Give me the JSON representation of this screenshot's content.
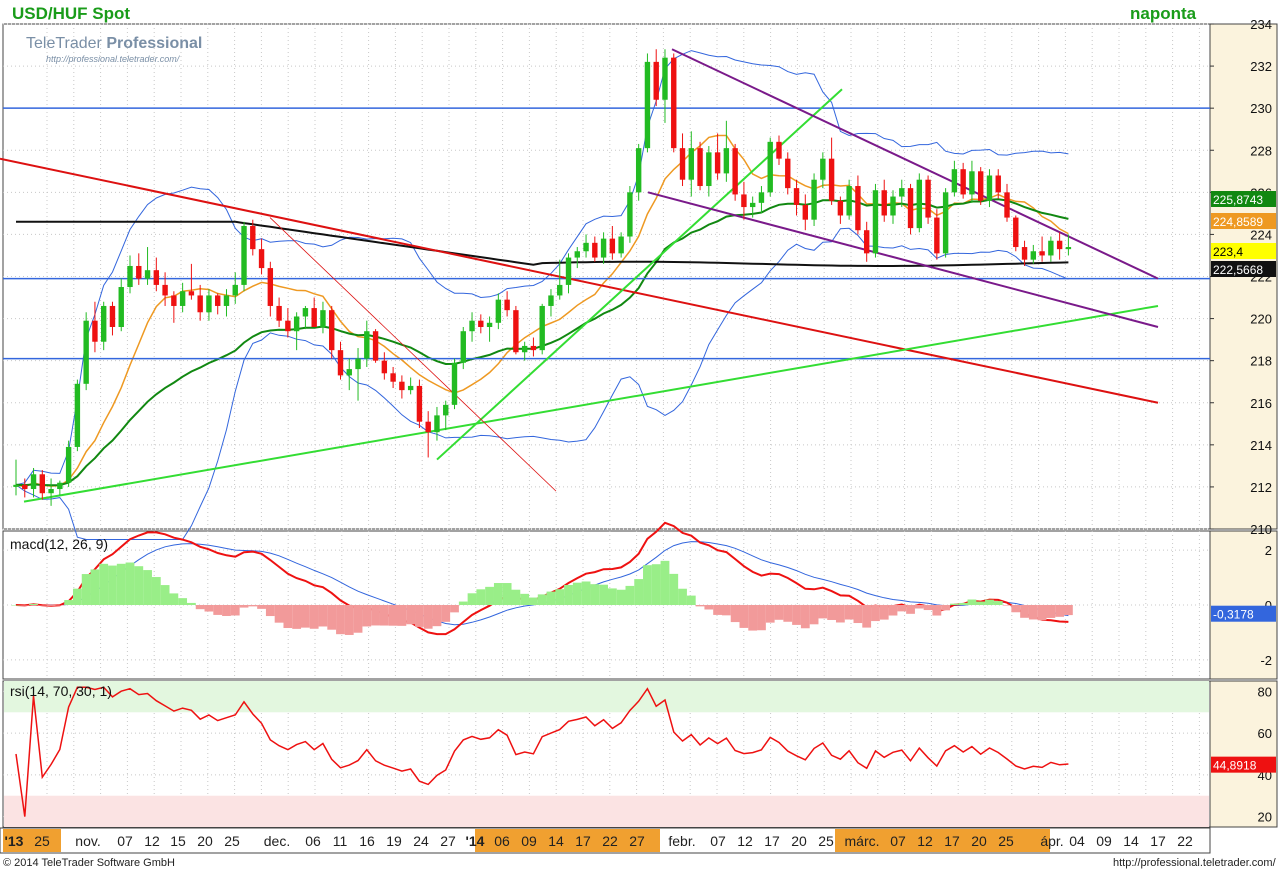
{
  "header": {
    "title": "USD/HUF Spot",
    "timeframe": "naponta",
    "logo_main": "TeleTrader",
    "logo_bold": "Professional",
    "logo_url": "http://professional.teletrader.com/"
  },
  "footer": {
    "copyright": "© 2014 TeleTrader Software GmbH",
    "url": "http://professional.teletrader.com/"
  },
  "x_axis": {
    "labels": [
      "'13",
      "25",
      "nov.",
      "07",
      "12",
      "15",
      "20",
      "25",
      "dec.",
      "06",
      "11",
      "16",
      "19",
      "24",
      "27",
      "'14",
      "06",
      "09",
      "14",
      "17",
      "22",
      "27",
      "febr.",
      "07",
      "12",
      "17",
      "20",
      "25",
      "márc.",
      "07",
      "12",
      "17",
      "20",
      "25",
      "ápr.",
      "04",
      "09",
      "14",
      "17",
      "22"
    ]
  },
  "colors": {
    "price_up": "#22bb22",
    "price_down": "#ee1111",
    "bollinger": "#3366dd",
    "sma_short": "#ee9922",
    "sma_mid": "#118811",
    "sma_long": "#111111",
    "trend_red": "#dd1111",
    "trend_green": "#33dd33",
    "channel_purple": "#7a1a8a",
    "support_blue": "#3366dd",
    "axis_strip": "#f0a030"
  },
  "chart_data": [
    {
      "type": "line",
      "title": "USD/HUF Spot",
      "ylim": [
        210,
        234
      ],
      "y_ticks": [
        "234",
        "232",
        "230",
        "228",
        "226",
        "224",
        "222",
        "220",
        "218",
        "216",
        "214",
        "212",
        "210"
      ],
      "price_labels": [
        {
          "value": 225.8743,
          "text": "225,8743",
          "bg": "#118811",
          "fg": "#ffffff"
        },
        {
          "value": 224.8589,
          "text": "224,8589",
          "bg": "#ee9922",
          "fg": "#ffffff"
        },
        {
          "value": 223.4,
          "text": "223,4",
          "bg": "#ffff00",
          "fg": "#000000"
        },
        {
          "value": 222.5668,
          "text": "222,5668",
          "bg": "#111111",
          "fg": "#ffffff"
        }
      ],
      "horizontal_lines": [
        230.0,
        221.9,
        218.1
      ],
      "trend_lines": [
        {
          "color": "red",
          "from": [
            0,
            227.6
          ],
          "to": [
            1158,
            216.0
          ]
        },
        {
          "color": "green",
          "from": [
            24,
            211.3
          ],
          "to": [
            1158,
            220.6
          ]
        },
        {
          "color": "green",
          "from": [
            437,
            213.3
          ],
          "to": [
            842,
            230.9
          ]
        },
        {
          "color": "red_thin",
          "from": [
            270,
            224.8
          ],
          "to": [
            556,
            211.8
          ]
        },
        {
          "color": "purple",
          "from": [
            672,
            232.8
          ],
          "to": [
            1158,
            221.9
          ]
        },
        {
          "color": "purple",
          "from": [
            648,
            226.0
          ],
          "to": [
            1158,
            219.6
          ]
        }
      ],
      "candles": [
        [
          212,
          213.3,
          211.6,
          212.1
        ],
        [
          212.1,
          212.4,
          211.5,
          211.9
        ],
        [
          211.9,
          212.9,
          211.5,
          212.6
        ],
        [
          212.6,
          212.8,
          211.4,
          211.7
        ],
        [
          211.7,
          212.4,
          211.1,
          211.9
        ],
        [
          211.9,
          212.3,
          211.6,
          212.2
        ],
        [
          212.2,
          214.2,
          212.0,
          213.9
        ],
        [
          213.9,
          217.1,
          213.7,
          216.9
        ],
        [
          216.9,
          220.3,
          216.6,
          219.9
        ],
        [
          219.9,
          220.8,
          218.4,
          218.9
        ],
        [
          218.9,
          220.8,
          218.5,
          220.6
        ],
        [
          220.6,
          220.8,
          219.2,
          219.6
        ],
        [
          219.6,
          221.9,
          219.4,
          221.5
        ],
        [
          221.5,
          223.0,
          221.2,
          222.5
        ],
        [
          222.5,
          223.1,
          221.6,
          221.9
        ],
        [
          221.9,
          223.4,
          221.6,
          222.3
        ],
        [
          222.3,
          222.9,
          221.3,
          221.6
        ],
        [
          221.6,
          222.2,
          220.6,
          221.1
        ],
        [
          221.1,
          221.3,
          219.8,
          220.6
        ],
        [
          220.6,
          221.7,
          220.3,
          221.3
        ],
        [
          221.3,
          222.6,
          220.9,
          221.1
        ],
        [
          221.1,
          221.6,
          219.9,
          220.3
        ],
        [
          220.3,
          221.4,
          219.9,
          221.1
        ],
        [
          221.1,
          221.2,
          220.2,
          220.6
        ],
        [
          220.6,
          221.4,
          220.1,
          221.1
        ],
        [
          221.1,
          222.2,
          220.7,
          221.6
        ],
        [
          221.6,
          224.6,
          221.3,
          224.4
        ],
        [
          224.4,
          224.7,
          223.0,
          223.3
        ],
        [
          223.3,
          223.8,
          222.1,
          222.4
        ],
        [
          222.4,
          222.7,
          220.1,
          220.6
        ],
        [
          220.6,
          221.0,
          219.6,
          219.9
        ],
        [
          219.9,
          220.5,
          219.1,
          219.4
        ],
        [
          219.4,
          220.3,
          218.5,
          220.1
        ],
        [
          220.1,
          220.6,
          219.5,
          220.5
        ],
        [
          220.5,
          221.0,
          219.6,
          219.6
        ],
        [
          219.6,
          220.8,
          219.3,
          220.4
        ],
        [
          220.4,
          220.6,
          218.1,
          218.5
        ],
        [
          218.5,
          218.9,
          217.1,
          217.3
        ],
        [
          217.3,
          218.1,
          216.6,
          217.6
        ],
        [
          217.6,
          218.6,
          216.1,
          218.1
        ],
        [
          218.1,
          219.9,
          217.7,
          219.4
        ],
        [
          219.4,
          219.5,
          217.9,
          218.0
        ],
        [
          218.0,
          218.4,
          217.1,
          217.4
        ],
        [
          217.4,
          217.7,
          216.7,
          217.0
        ],
        [
          217.0,
          217.3,
          216.2,
          216.6
        ],
        [
          216.6,
          217.2,
          216.4,
          216.8
        ],
        [
          216.8,
          217.1,
          214.8,
          215.1
        ],
        [
          215.1,
          215.6,
          213.4,
          214.6
        ],
        [
          214.6,
          215.8,
          214.2,
          215.4
        ],
        [
          215.4,
          216.1,
          214.7,
          215.9
        ],
        [
          215.9,
          218.1,
          215.7,
          217.9
        ],
        [
          217.9,
          219.6,
          217.6,
          219.4
        ],
        [
          219.4,
          220.3,
          218.9,
          219.9
        ],
        [
          219.9,
          220.2,
          219.3,
          219.6
        ],
        [
          219.6,
          220.1,
          218.9,
          219.8
        ],
        [
          219.8,
          221.2,
          219.5,
          220.9
        ],
        [
          220.9,
          221.3,
          220.1,
          220.4
        ],
        [
          220.4,
          220.6,
          218.3,
          218.4
        ],
        [
          218.4,
          218.9,
          218.0,
          218.7
        ],
        [
          218.7,
          219.1,
          218.2,
          218.5
        ],
        [
          218.5,
          220.7,
          218.3,
          220.6
        ],
        [
          220.6,
          221.4,
          220.1,
          221.1
        ],
        [
          221.1,
          222.8,
          220.9,
          221.6
        ],
        [
          221.6,
          223.1,
          221.2,
          222.9
        ],
        [
          222.9,
          223.4,
          222.4,
          223.2
        ],
        [
          223.2,
          224.0,
          222.9,
          223.6
        ],
        [
          223.6,
          223.9,
          222.7,
          222.9
        ],
        [
          222.9,
          224.1,
          222.6,
          223.8
        ],
        [
          223.8,
          224.4,
          222.8,
          223.1
        ],
        [
          223.1,
          224.1,
          222.9,
          223.9
        ],
        [
          223.9,
          226.3,
          223.6,
          226.0
        ],
        [
          226.0,
          228.3,
          225.6,
          228.1
        ],
        [
          228.1,
          232.6,
          227.9,
          232.2
        ],
        [
          232.2,
          232.8,
          230.1,
          230.4
        ],
        [
          230.4,
          232.8,
          229.3,
          232.4
        ],
        [
          232.4,
          232.6,
          227.9,
          228.1
        ],
        [
          228.1,
          228.8,
          226.3,
          226.6
        ],
        [
          226.6,
          228.9,
          225.8,
          228.1
        ],
        [
          228.1,
          228.4,
          226.1,
          226.3
        ],
        [
          226.3,
          228.2,
          225.8,
          227.9
        ],
        [
          227.9,
          228.8,
          226.6,
          226.9
        ],
        [
          226.9,
          229.4,
          226.5,
          228.1
        ],
        [
          228.1,
          228.3,
          225.6,
          225.9
        ],
        [
          225.9,
          226.5,
          224.7,
          225.3
        ],
        [
          225.3,
          225.8,
          224.8,
          225.5
        ],
        [
          225.5,
          226.3,
          225.0,
          226.0
        ],
        [
          226.0,
          228.6,
          225.8,
          228.4
        ],
        [
          228.4,
          228.7,
          227.3,
          227.6
        ],
        [
          227.6,
          227.9,
          225.9,
          226.2
        ],
        [
          226.2,
          226.6,
          224.9,
          225.4
        ],
        [
          225.4,
          225.9,
          224.2,
          224.7
        ],
        [
          224.7,
          226.9,
          224.4,
          226.6
        ],
        [
          226.6,
          227.9,
          226.2,
          227.6
        ],
        [
          227.6,
          228.6,
          225.4,
          225.6
        ],
        [
          225.6,
          225.8,
          224.5,
          224.9
        ],
        [
          224.9,
          226.6,
          224.7,
          226.3
        ],
        [
          226.3,
          226.8,
          224.0,
          224.2
        ],
        [
          224.2,
          224.6,
          222.7,
          223.1
        ],
        [
          223.1,
          226.4,
          222.9,
          226.1
        ],
        [
          226.1,
          226.6,
          224.6,
          224.9
        ],
        [
          224.9,
          226.1,
          224.5,
          225.8
        ],
        [
          225.8,
          226.6,
          225.3,
          226.2
        ],
        [
          226.2,
          226.4,
          224.0,
          224.3
        ],
        [
          224.3,
          226.9,
          224.1,
          226.6
        ],
        [
          226.6,
          226.8,
          224.5,
          224.8
        ],
        [
          224.8,
          225.2,
          222.8,
          223.1
        ],
        [
          223.1,
          226.2,
          222.9,
          226.0
        ],
        [
          226.0,
          227.5,
          225.8,
          227.1
        ],
        [
          227.1,
          227.4,
          225.7,
          225.9
        ],
        [
          225.9,
          227.5,
          225.5,
          227.0
        ],
        [
          227.0,
          227.2,
          225.4,
          225.6
        ],
        [
          225.6,
          227.1,
          225.3,
          226.8
        ],
        [
          226.8,
          227.1,
          225.7,
          226.0
        ],
        [
          226.0,
          226.4,
          224.6,
          224.8
        ],
        [
          224.8,
          224.9,
          223.2,
          223.4
        ],
        [
          223.4,
          223.7,
          222.5,
          222.8
        ],
        [
          222.8,
          223.5,
          222.6,
          223.2
        ],
        [
          223.2,
          223.9,
          222.7,
          223.0
        ],
        [
          223.0,
          223.9,
          222.7,
          223.7
        ],
        [
          223.7,
          224.1,
          222.8,
          223.3
        ],
        [
          223.3,
          224.0,
          223.0,
          223.4
        ]
      ]
    },
    {
      "type": "line",
      "title": "macd(12, 26, 9)",
      "ylim": [
        -2.7,
        2.7
      ],
      "y_ticks": [
        "2",
        "0",
        "-2"
      ],
      "value_label": {
        "value": -0.3178,
        "text": "-0,3178",
        "bg": "#3366dd",
        "fg": "#ffffff"
      }
    },
    {
      "type": "line",
      "title": "rsi(14, 70, 30, 1)",
      "ylim": [
        15,
        85
      ],
      "y_ticks": [
        "80",
        "60",
        "40",
        "20"
      ],
      "overbought": 70,
      "oversold": 30,
      "value_label": {
        "value": 44.8918,
        "text": "44,8918",
        "bg": "#ee1111",
        "fg": "#ffffff"
      }
    }
  ]
}
